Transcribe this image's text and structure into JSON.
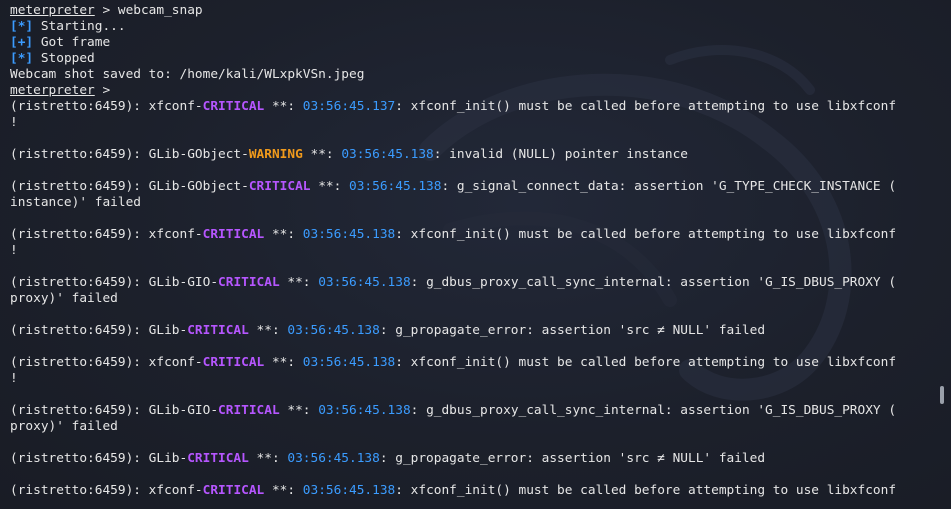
{
  "terminal": {
    "colors": {
      "background": "#1b1f29",
      "text": "#e6e6e6",
      "critical": "#b656ff",
      "warning": "#f09a1c",
      "timestamp": "#3b9cff",
      "tag": "#3b9cff"
    },
    "header": [
      {
        "kind": "prompt",
        "prompt": "meterpreter",
        "rest": " > webcam_snap"
      },
      {
        "kind": "tag",
        "tag": "[*]",
        "text": " Starting..."
      },
      {
        "kind": "tag",
        "tag": "[+]",
        "text": " Got frame"
      },
      {
        "kind": "tag",
        "tag": "[*]",
        "text": " Stopped"
      },
      {
        "kind": "plain",
        "text": "Webcam shot saved to: /home/kali/WLxpkVSn.jpeg"
      },
      {
        "kind": "prompt",
        "prompt": "meterpreter",
        "rest": " > "
      }
    ],
    "log": [
      {
        "pre": "(ristretto:6459): xfconf-",
        "level": "CRITICAL",
        "mid": " **: ",
        "time": "03:56:45.137",
        "msg": ": xfconf_init() must be called before attempting to use libxfconf",
        "cont": "!"
      },
      {
        "pre": "",
        "level": "",
        "mid": "",
        "time": "",
        "msg": "",
        "cont": null,
        "blank": true
      },
      {
        "pre": "(ristretto:6459): GLib-GObject-",
        "level": "WARNING",
        "mid": " **: ",
        "time": "03:56:45.138",
        "msg": ": invalid (NULL) pointer instance",
        "cont": null
      },
      {
        "pre": "",
        "level": "",
        "mid": "",
        "time": "",
        "msg": "",
        "cont": null,
        "blank": true
      },
      {
        "pre": "(ristretto:6459): GLib-GObject-",
        "level": "CRITICAL",
        "mid": " **: ",
        "time": "03:56:45.138",
        "msg": ": g_signal_connect_data: assertion 'G_TYPE_CHECK_INSTANCE (",
        "cont": "instance)' failed"
      },
      {
        "pre": "",
        "level": "",
        "mid": "",
        "time": "",
        "msg": "",
        "cont": null,
        "blank": true
      },
      {
        "pre": "(ristretto:6459): xfconf-",
        "level": "CRITICAL",
        "mid": " **: ",
        "time": "03:56:45.138",
        "msg": ": xfconf_init() must be called before attempting to use libxfconf",
        "cont": "!"
      },
      {
        "pre": "",
        "level": "",
        "mid": "",
        "time": "",
        "msg": "",
        "cont": null,
        "blank": true
      },
      {
        "pre": "(ristretto:6459): GLib-GIO-",
        "level": "CRITICAL",
        "mid": " **: ",
        "time": "03:56:45.138",
        "msg": ": g_dbus_proxy_call_sync_internal: assertion 'G_IS_DBUS_PROXY (",
        "cont": "proxy)' failed"
      },
      {
        "pre": "",
        "level": "",
        "mid": "",
        "time": "",
        "msg": "",
        "cont": null,
        "blank": true
      },
      {
        "pre": "(ristretto:6459): GLib-",
        "level": "CRITICAL",
        "mid": " **: ",
        "time": "03:56:45.138",
        "msg": ": g_propagate_error: assertion 'src ≠ NULL' failed",
        "cont": null
      },
      {
        "pre": "",
        "level": "",
        "mid": "",
        "time": "",
        "msg": "",
        "cont": null,
        "blank": true
      },
      {
        "pre": "(ristretto:6459): xfconf-",
        "level": "CRITICAL",
        "mid": " **: ",
        "time": "03:56:45.138",
        "msg": ": xfconf_init() must be called before attempting to use libxfconf",
        "cont": "!"
      },
      {
        "pre": "",
        "level": "",
        "mid": "",
        "time": "",
        "msg": "",
        "cont": null,
        "blank": true
      },
      {
        "pre": "(ristretto:6459): GLib-GIO-",
        "level": "CRITICAL",
        "mid": " **: ",
        "time": "03:56:45.138",
        "msg": ": g_dbus_proxy_call_sync_internal: assertion 'G_IS_DBUS_PROXY (",
        "cont": "proxy)' failed"
      },
      {
        "pre": "",
        "level": "",
        "mid": "",
        "time": "",
        "msg": "",
        "cont": null,
        "blank": true
      },
      {
        "pre": "(ristretto:6459): GLib-",
        "level": "CRITICAL",
        "mid": " **: ",
        "time": "03:56:45.138",
        "msg": ": g_propagate_error: assertion 'src ≠ NULL' failed",
        "cont": null
      },
      {
        "pre": "",
        "level": "",
        "mid": "",
        "time": "",
        "msg": "",
        "cont": null,
        "blank": true
      },
      {
        "pre": "(ristretto:6459): xfconf-",
        "level": "CRITICAL",
        "mid": " **: ",
        "time": "03:56:45.138",
        "msg": ": xfconf_init() must be called before attempting to use libxfconf",
        "cont": null
      }
    ]
  }
}
